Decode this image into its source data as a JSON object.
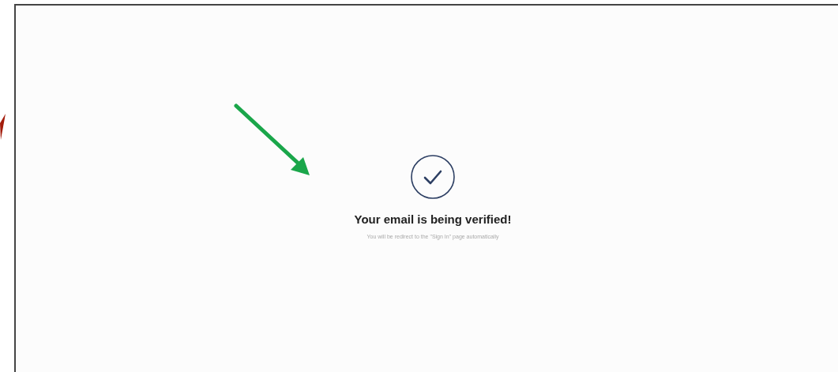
{
  "message": {
    "title": "Your email is being verified!",
    "subtitle": "You will be redirect to the \"Sign In\" page automatically"
  }
}
